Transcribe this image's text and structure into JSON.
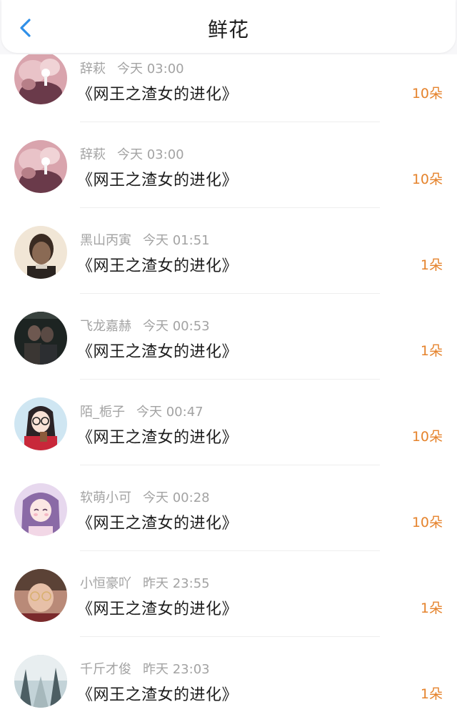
{
  "header": {
    "title": "鲜花",
    "back_icon": "chevron-left-icon",
    "accent": "#2f8fe8"
  },
  "list": {
    "count_color": "#e5832c",
    "items": [
      {
        "name": "辞萩",
        "time": "今天 03:00",
        "book": "《网王之渣女的进化》",
        "count": "10朵",
        "avatar": "pink-headphones-avatar"
      },
      {
        "name": "辞萩",
        "time": "今天 03:00",
        "book": "《网王之渣女的进化》",
        "count": "10朵",
        "avatar": "pink-headphones-avatar"
      },
      {
        "name": "黑山丙寅",
        "time": "今天 01:51",
        "book": "《网王之渣女的进化》",
        "count": "1朵",
        "avatar": "man-portrait-avatar"
      },
      {
        "name": "飞龙嘉赫",
        "time": "今天 00:53",
        "book": "《网王之渣女的进化》",
        "count": "1朵",
        "avatar": "dark-couple-avatar"
      },
      {
        "name": "陌_栀子",
        "time": "今天 00:47",
        "book": "《网王之渣女的进化》",
        "count": "10朵",
        "avatar": "anime-girl-glasses-avatar"
      },
      {
        "name": "软萌小可",
        "time": "今天 00:28",
        "book": "《网王之渣女的进化》",
        "count": "10朵",
        "avatar": "anime-girl-purple-avatar"
      },
      {
        "name": "小恒豪吖",
        "time": "昨天 23:55",
        "book": "《网王之渣女的进化》",
        "count": "1朵",
        "avatar": "boy-glasses-avatar"
      },
      {
        "name": "千斤才俊",
        "time": "昨天 23:03",
        "book": "《网王之渣女的进化》",
        "count": "1朵",
        "avatar": "snowy-forest-avatar"
      }
    ]
  }
}
